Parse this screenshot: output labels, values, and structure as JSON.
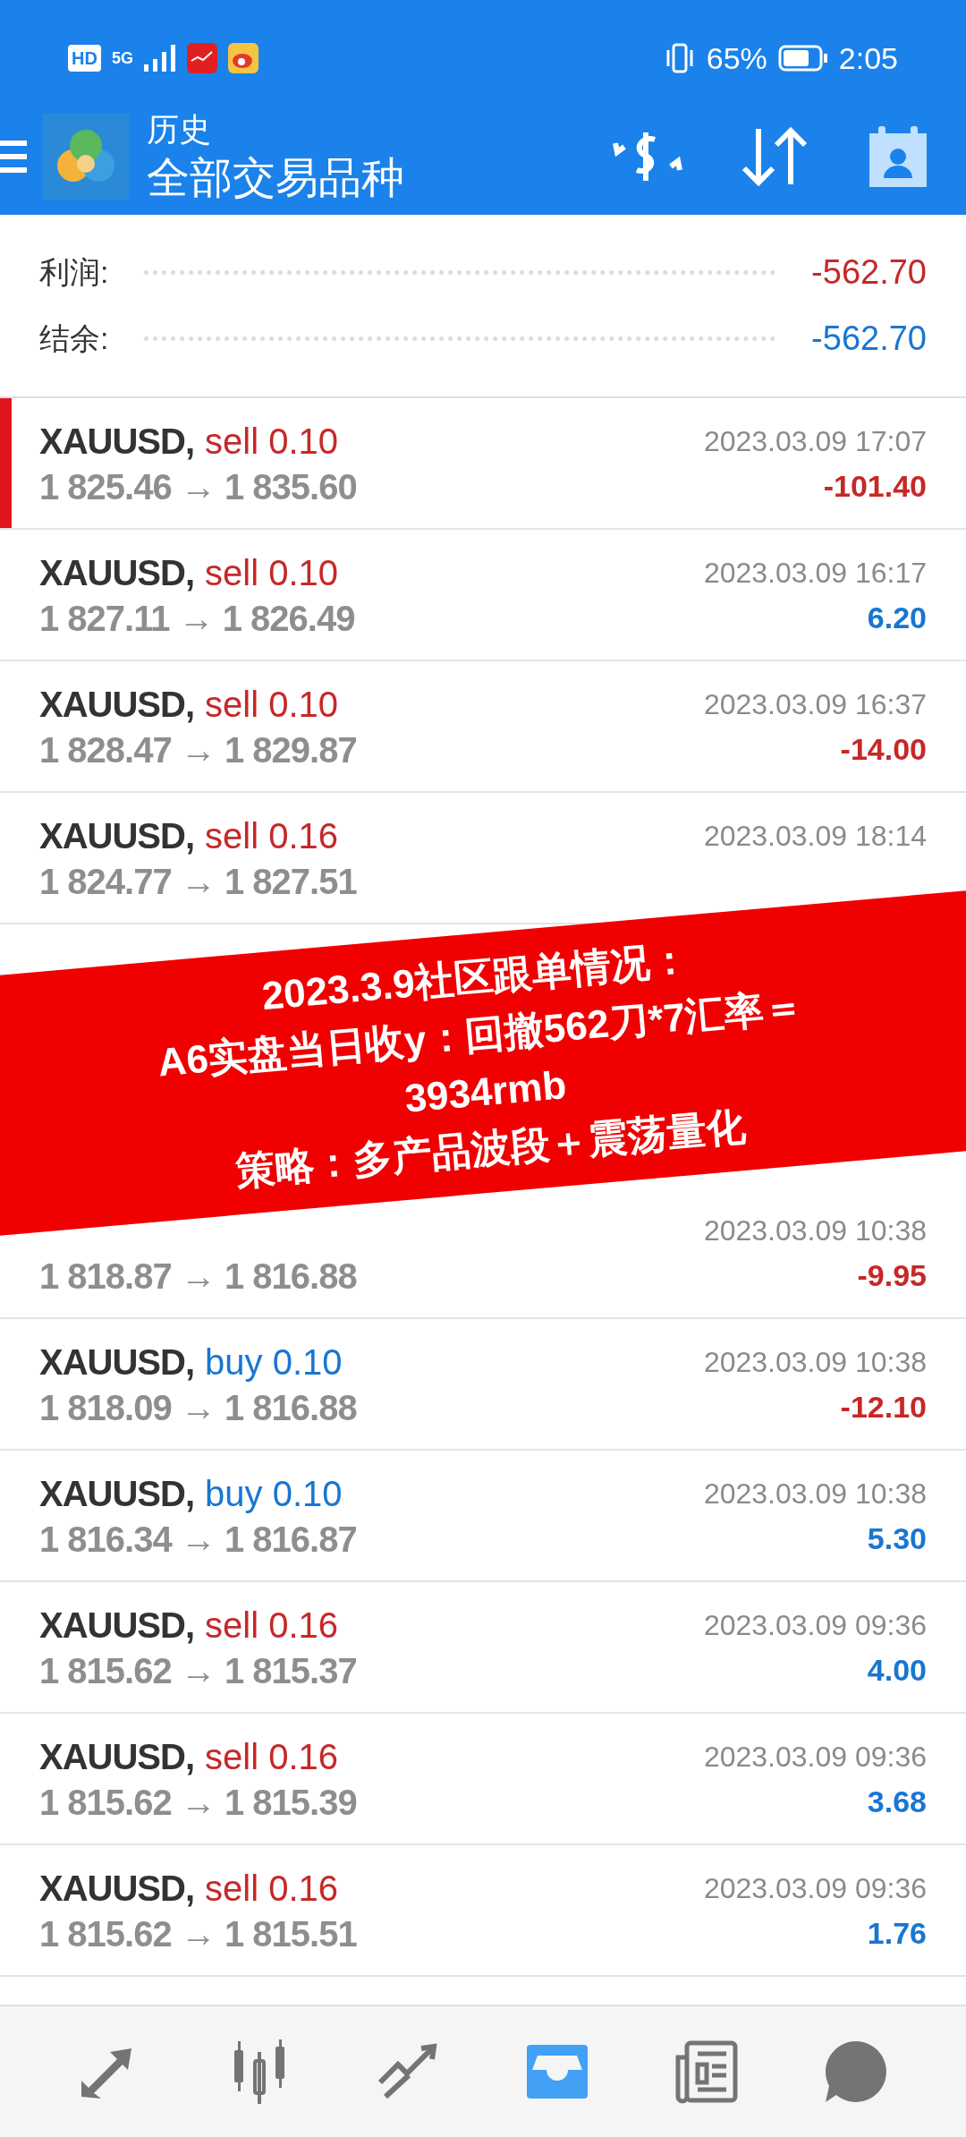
{
  "status_bar": {
    "hd": "HD",
    "network": "5G",
    "battery": "65%",
    "time": "2:05"
  },
  "app_bar": {
    "title": "历史",
    "subtitle": "全部交易品种"
  },
  "summary": [
    {
      "label": "利润:",
      "value": "-562.70",
      "kind": "loss"
    },
    {
      "label": "结余:",
      "value": "-562.70",
      "kind": "gain"
    }
  ],
  "trades": [
    {
      "symbol": "XAUUSD,",
      "sell": true,
      "lot": "sell 0.10",
      "time": "2023.03.09 17:07",
      "prices": "1 825.46 → 1 835.60",
      "profit": "-101.40",
      "kind": "loss",
      "selected": true
    },
    {
      "symbol": "XAUUSD,",
      "sell": true,
      "lot": "sell 0.10",
      "time": "2023.03.09 16:17",
      "prices": "1 827.11 → 1 826.49",
      "profit": "6.20",
      "kind": "gain",
      "selected": false
    },
    {
      "symbol": "XAUUSD,",
      "sell": true,
      "lot": "sell 0.10",
      "time": "2023.03.09 16:37",
      "prices": "1 828.47 → 1 829.87",
      "profit": "-14.00",
      "kind": "loss",
      "selected": false
    },
    {
      "symbol": "XAUUSD,",
      "sell": true,
      "lot": "sell 0.16",
      "time": "2023.03.09 18:14",
      "prices": "1 824.77 → 1 827.51",
      "selected": false
    }
  ],
  "banner": [
    "2023.3.9社区跟单情况：",
    "A6实盘当日收y：回撤562刀*7汇率＝",
    "3934rmb",
    "策略：多产品波段＋震荡量化"
  ],
  "trades_below": [
    {
      "time": "2023.03.09 10:38",
      "prices": "1 818.87 → 1 816.88",
      "profit": "-9.95",
      "kind": "loss",
      "selected": false
    },
    {
      "symbol": "XAUUSD,",
      "sell": false,
      "lot": "buy 0.10",
      "time": "2023.03.09 10:38",
      "prices": "1 818.09 → 1 816.88",
      "profit": "-12.10",
      "kind": "loss",
      "selected": false
    },
    {
      "symbol": "XAUUSD,",
      "sell": false,
      "lot": "buy 0.10",
      "time": "2023.03.09 10:38",
      "prices": "1 816.34 → 1 816.87",
      "profit": "5.30",
      "kind": "gain",
      "selected": false
    },
    {
      "symbol": "XAUUSD,",
      "sell": true,
      "lot": "sell 0.16",
      "time": "2023.03.09 09:36",
      "prices": "1 815.62 → 1 815.37",
      "profit": "4.00",
      "kind": "gain",
      "selected": false
    },
    {
      "symbol": "XAUUSD,",
      "sell": true,
      "lot": "sell 0.16",
      "time": "2023.03.09 09:36",
      "prices": "1 815.62 → 1 815.39",
      "profit": "3.68",
      "kind": "gain",
      "selected": false
    },
    {
      "symbol": "XAUUSD,",
      "sell": true,
      "lot": "sell 0.16",
      "time": "2023.03.09 09:36",
      "prices": "1 815.62 → 1 815.51",
      "profit": "1.76",
      "kind": "gain",
      "selected": false
    }
  ],
  "nav": [
    {
      "selected": false
    },
    {
      "selected": false
    },
    {
      "selected": false
    },
    {
      "selected": true
    },
    {
      "selected": false
    },
    {
      "selected": false
    }
  ]
}
